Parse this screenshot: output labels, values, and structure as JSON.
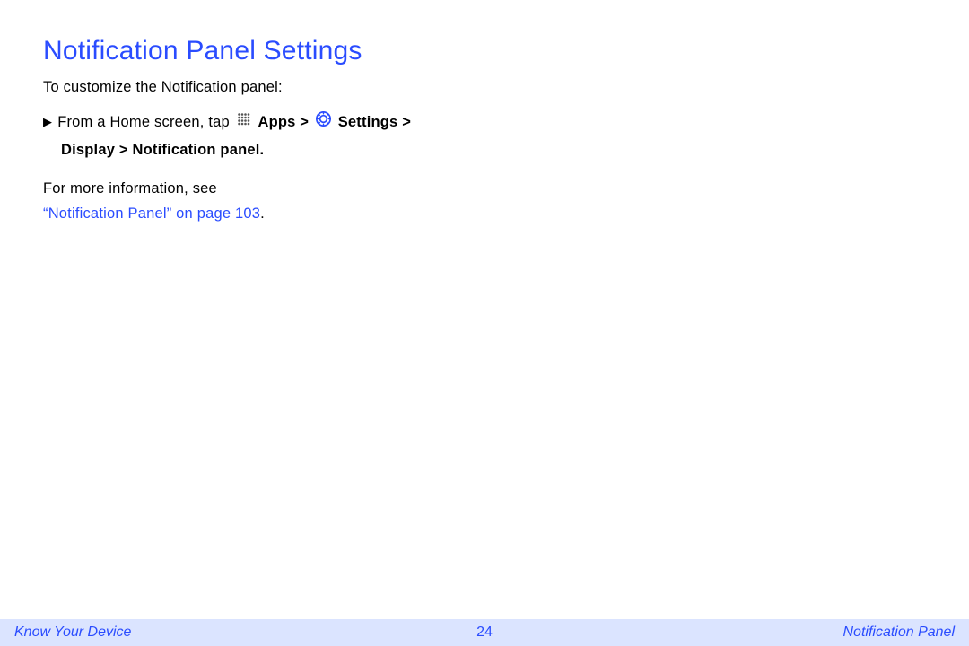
{
  "heading": "Notification Panel Settings",
  "intro": "To customize the Notification panel:",
  "step": {
    "prefix": "From a Home screen, tap ",
    "apps_label": "Apps",
    "gt1": " > ",
    "settings_label": "Settings",
    "gt2": " >",
    "line2": "Display > Notification panel",
    "period": "."
  },
  "more_info": {
    "lead": "For more information, see ",
    "xref": "“Notification Panel” on page 103",
    "period": "."
  },
  "footer": {
    "left": "Know Your Device",
    "center": "24",
    "right": "Notification Panel"
  },
  "icons": {
    "apps": "apps-grid-icon",
    "settings": "settings-gear-icon"
  }
}
